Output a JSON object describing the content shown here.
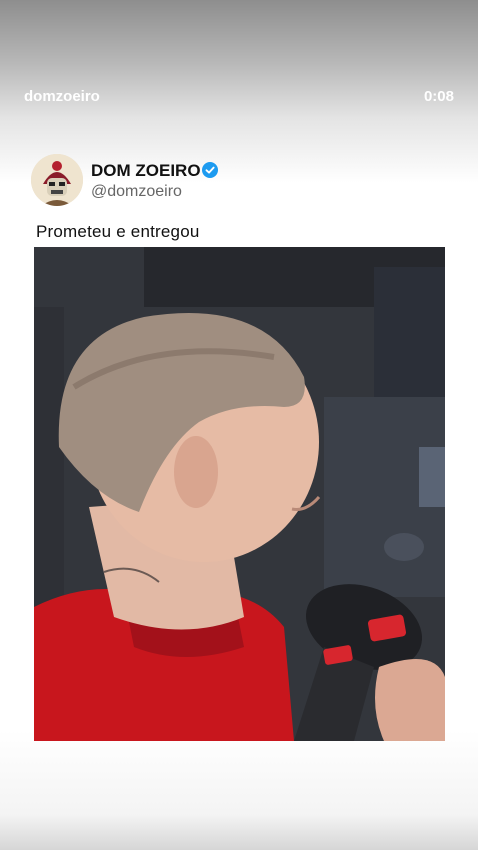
{
  "overlay": {
    "username": "domzoeiro",
    "duration": "0:08"
  },
  "post": {
    "display_name": "DOM ZOEIRO",
    "handle": "@domzoeiro",
    "caption": "Prometeu e entregou",
    "verified": true
  },
  "video": {
    "subject": "young man with buzzed hair in red shirt speaking into a black microphone"
  },
  "icons": {
    "verified": "verified-check-icon"
  },
  "colors": {
    "verified_blue": "#1d9bf0",
    "shirt_red": "#c8161d"
  }
}
